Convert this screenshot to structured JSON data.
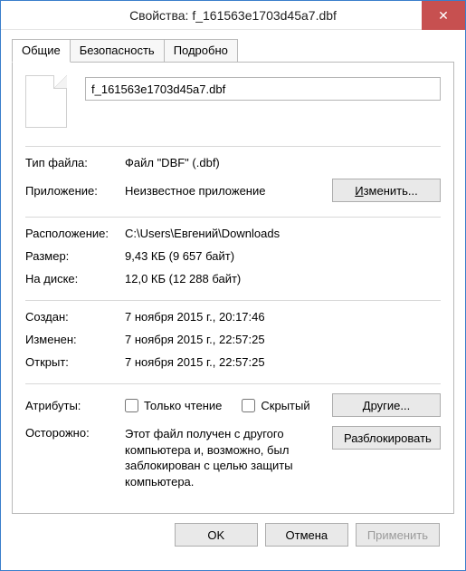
{
  "window": {
    "title": "Свойства: f_161563e1703d45a7.dbf"
  },
  "tabs": {
    "general": "Общие",
    "security": "Безопасность",
    "details": "Подробно"
  },
  "file": {
    "name": "f_161563e1703d45a7.dbf"
  },
  "labels": {
    "file_type": "Тип файла:",
    "application": "Приложение:",
    "location": "Расположение:",
    "size": "Размер:",
    "size_on_disk": "На диске:",
    "created": "Создан:",
    "modified": "Изменен:",
    "accessed": "Открыт:",
    "attributes": "Атрибуты:",
    "readonly": "Только чтение",
    "hidden": "Скрытый",
    "caution": "Осторожно:"
  },
  "values": {
    "file_type": "Файл \"DBF\" (.dbf)",
    "application": "Неизвестное приложение",
    "location": "C:\\Users\\Евгений\\Downloads",
    "size": "9,43 КБ (9 657 байт)",
    "size_on_disk": "12,0 КБ (12 288 байт)",
    "created": "7 ноября 2015 г., 20:17:46",
    "modified": "7 ноября 2015 г., 22:57:25",
    "accessed": "7 ноября 2015 г., 22:57:25",
    "caution": "Этот файл получен с другого компьютера и, возможно, был заблокирован с целью защиты компьютера."
  },
  "buttons": {
    "change": "Изменить...",
    "other": "Другие...",
    "unblock": "Разблокировать",
    "ok": "OK",
    "cancel": "Отмена",
    "apply": "Применить"
  }
}
